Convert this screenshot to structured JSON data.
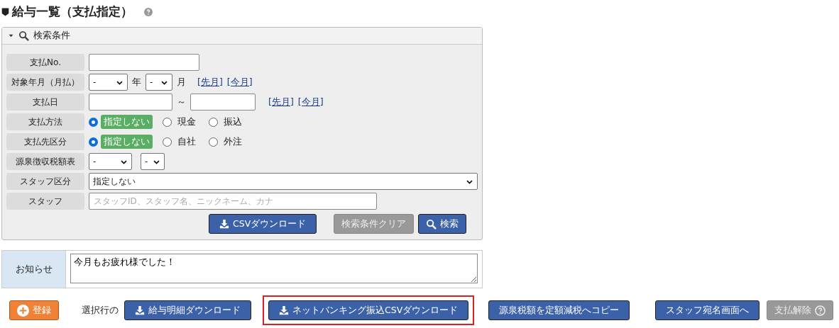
{
  "title": "給与一覧（支払指定）",
  "search_panel": {
    "header": "検索条件",
    "expanded": true,
    "rows": [
      {
        "kind": "text",
        "label": "支払No."
      },
      {
        "kind": "year_month",
        "label": "対象年月（月払）",
        "year": "-",
        "year_unit": "年",
        "month": "-",
        "month_unit": "月",
        "links": [
          "[先月]",
          "[今月]"
        ]
      },
      {
        "kind": "date_range",
        "label": "支払日",
        "separator": "～",
        "links": [
          "[先月]",
          "[今月]"
        ]
      },
      {
        "kind": "radio",
        "label": "支払方法",
        "options": [
          {
            "label": "指定しない",
            "selected": true
          },
          {
            "label": "現金",
            "selected": false
          },
          {
            "label": "振込",
            "selected": false
          }
        ]
      },
      {
        "kind": "radio",
        "label": "支払先区分",
        "options": [
          {
            "label": "指定しない",
            "selected": true
          },
          {
            "label": "自社",
            "selected": false
          },
          {
            "label": "外注",
            "selected": false
          }
        ]
      },
      {
        "kind": "two_selects",
        "label": "源泉徴収税額表",
        "values": [
          "-",
          "-"
        ]
      },
      {
        "kind": "select",
        "label": "スタッフ区分",
        "value": "指定しない"
      },
      {
        "kind": "text",
        "label": "スタッフ",
        "placeholder": "スタッフID、スタッフ名、ニックネーム、カナ"
      }
    ],
    "buttons": [
      {
        "label": "CSVダウンロード"
      },
      {
        "label": "検索条件クリア"
      },
      {
        "label": "検索"
      }
    ]
  },
  "notice": {
    "label": "お知らせ",
    "value": "今月もお疲れ様でした！"
  },
  "actions": [
    {
      "kind": "button",
      "label": "登録",
      "highlighted": false
    },
    {
      "kind": "text",
      "label": "選択行の"
    },
    {
      "kind": "button",
      "label": "給与明細ダウンロード",
      "highlighted": false
    },
    {
      "kind": "button",
      "label": "ネットバンキング振込CSVダウンロード",
      "highlighted": true
    },
    {
      "kind": "button",
      "label": "源泉税額を定額減税へコピー",
      "highlighted": false
    },
    {
      "kind": "button",
      "label": "スタッフ宛名画面へ",
      "highlighted": false
    },
    {
      "kind": "button",
      "label": "支払解除",
      "highlighted": false
    }
  ]
}
